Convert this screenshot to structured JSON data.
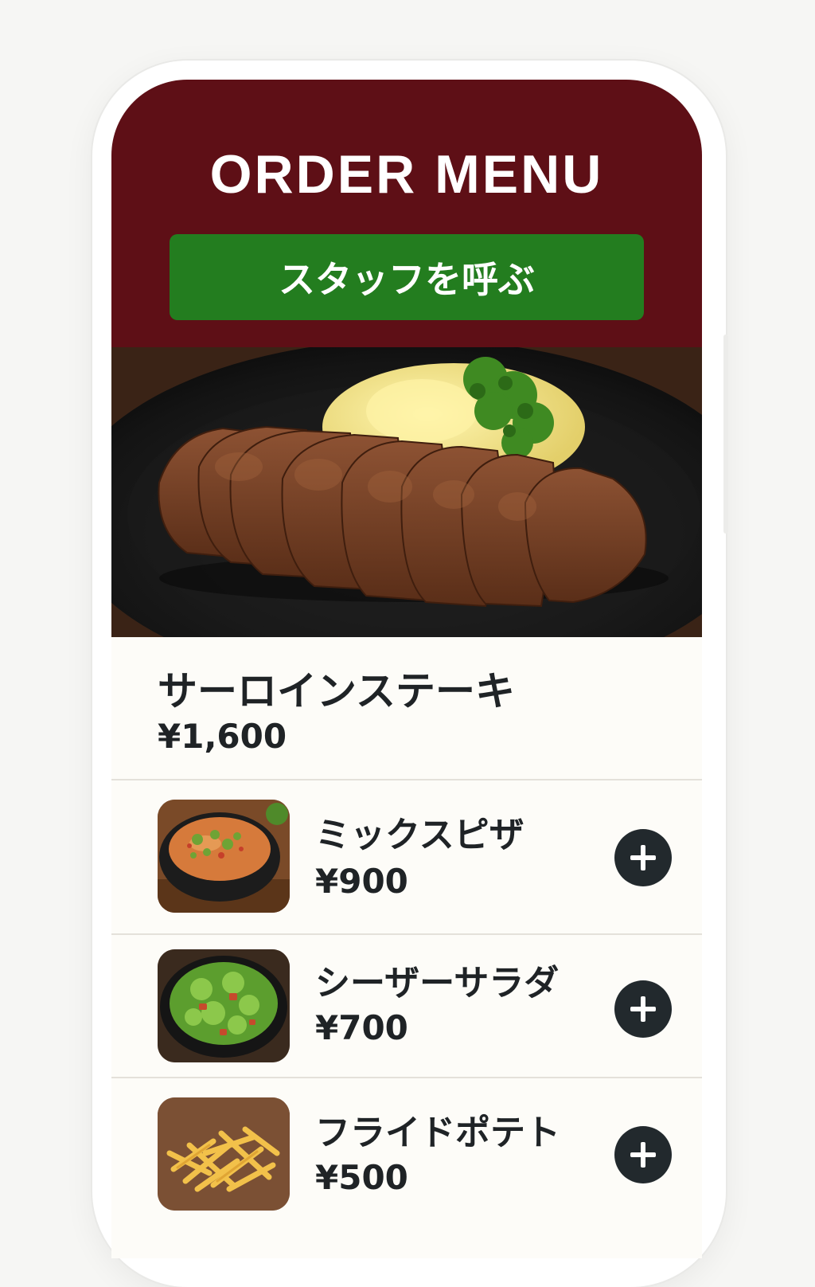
{
  "header": {
    "title": "ORDER MENU",
    "call_staff_label": "スタッフを呼ぶ"
  },
  "featured": {
    "name": "サーロインステーキ",
    "price": "¥1,600",
    "image": "sirloin-steak-photo"
  },
  "items": [
    {
      "name": "ミックスピザ",
      "price": "¥900",
      "image": "mixed-pizza-photo",
      "action_icon": "plus-icon"
    },
    {
      "name": "シーザーサラダ",
      "price": "¥700",
      "image": "caesar-salad-photo",
      "action_icon": "plus-icon"
    },
    {
      "name": "フライドポテト",
      "price": "¥500",
      "image": "french-fries-photo",
      "action_icon": "plus-icon"
    }
  ],
  "colors": {
    "header_bg": "#5e0f16",
    "call_button_bg": "#237d1f",
    "add_button_bg": "#22292d",
    "list_bg": "#fdfcf8"
  }
}
